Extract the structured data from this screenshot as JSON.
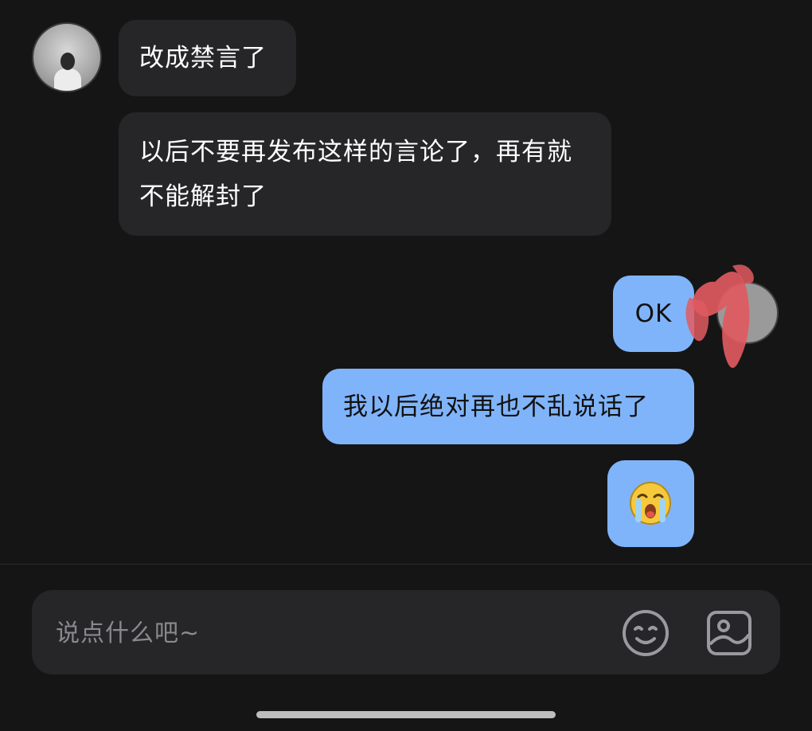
{
  "messages": [
    {
      "id": "msg-1",
      "direction": "incoming",
      "text": "改成禁言了"
    },
    {
      "id": "msg-2",
      "direction": "incoming",
      "text": "以后不要再发布这样的言论了，再有就不能解封了"
    },
    {
      "id": "msg-3",
      "direction": "outgoing",
      "text": "OK"
    },
    {
      "id": "msg-4",
      "direction": "outgoing",
      "text": "我以后绝对再也不乱说话了"
    },
    {
      "id": "msg-5",
      "direction": "outgoing",
      "emoji": "crying-emoji-icon"
    }
  ],
  "input": {
    "placeholder": "说点什么吧~"
  },
  "icons": {
    "emoji_button": "smile-face-icon",
    "image_button": "image-icon"
  },
  "colors": {
    "background": "#151516",
    "incoming_bubble": "#262628",
    "outgoing_bubble": "#80b4fa",
    "input_bar": "#262628",
    "redaction": "#e05a60"
  }
}
